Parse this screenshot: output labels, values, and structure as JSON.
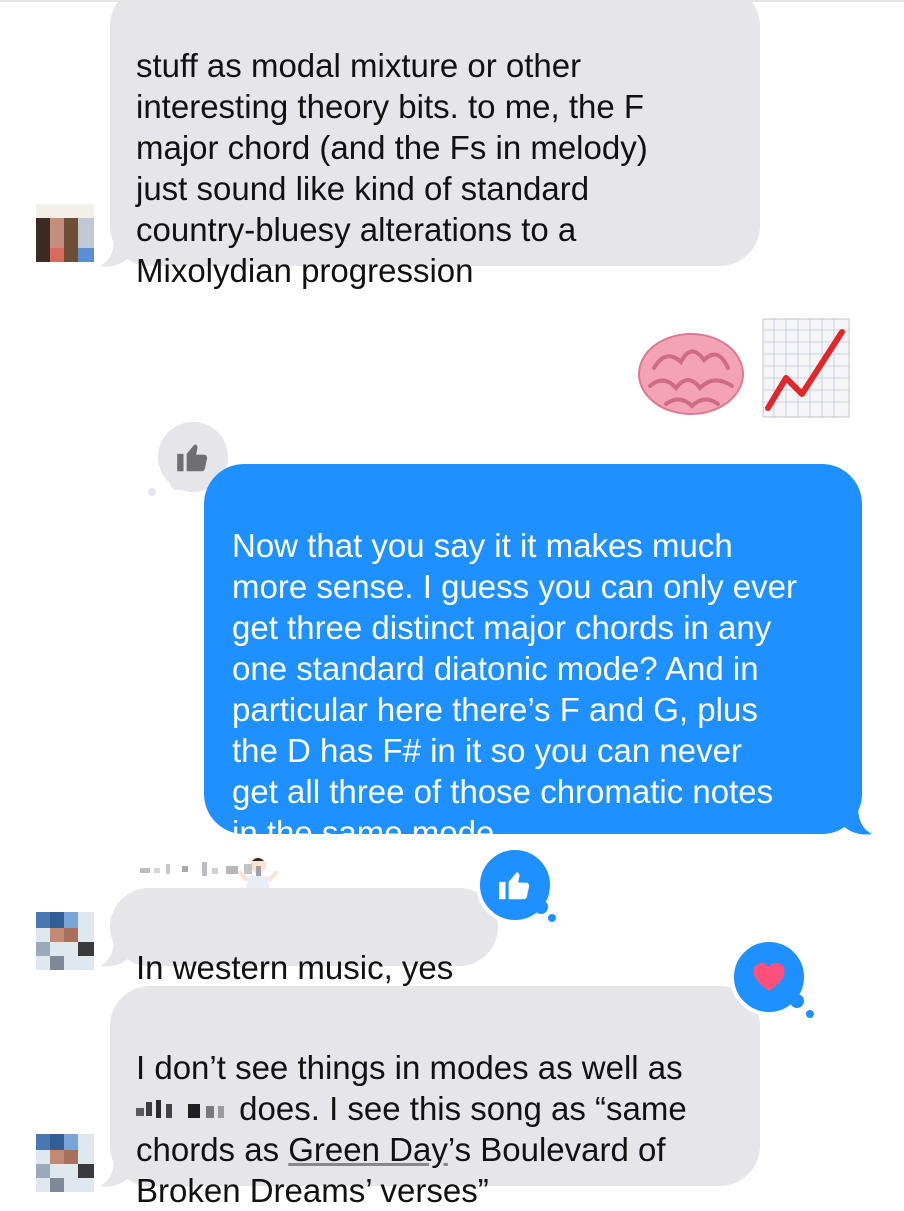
{
  "messages": [
    {
      "sender": "contact",
      "text": "stuff as modal mixture or other\ninteresting theory bits. to me, the F\nmajor chord (and the Fs in melody)\njust sound like kind of standard\ncountry-bluesy alterations to a\nMixolydian progression"
    },
    {
      "sender": "contact",
      "emoji": [
        "brain-emoji",
        "chart-increasing-emoji"
      ]
    },
    {
      "sender": "me",
      "text": "Now that you say it it makes much\nmore sense. I guess you can only ever\nget three distinct major chords in any\none standard diatonic mode? And in\nparticular here there’s F and G, plus\nthe D has F# in it so you can never\nget all three of those chromatic notes\nin the same mode",
      "trailing_emoji": "shrug-emoji",
      "tapback": "thumbs-up"
    },
    {
      "sender": "contact",
      "sender_name": "redacted",
      "text": "In western music, yes",
      "tapback": "thumbs-up"
    },
    {
      "sender": "contact",
      "text_before": "I don’t see things in modes as well as\n",
      "redacted": "redacted-name",
      "text_after": " does. I see this song as “same\nchords as ",
      "link": "Green Day",
      "text_end": "’s Boulevard of\nBroken Dreams’ verses”",
      "tapback": "heart"
    }
  ],
  "colors": {
    "incoming_bubble": "#e5e5ea",
    "outgoing_bubble": "#1e90ff",
    "tapback_active": "#1e90ff",
    "tapback_inactive": "#e5e5ea",
    "heart": "#ff4f7b"
  }
}
